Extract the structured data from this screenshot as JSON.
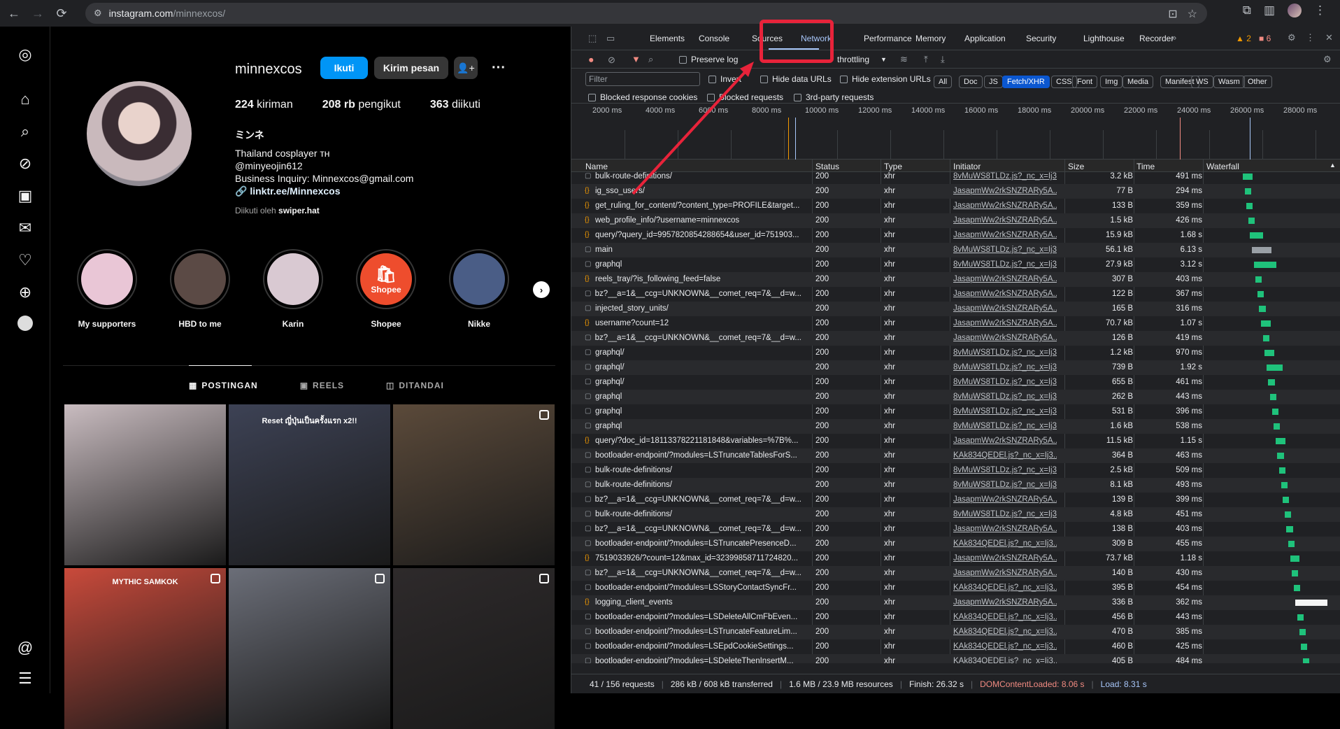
{
  "browser": {
    "url_domain": "instagram.com",
    "url_path": "/minnexcos/"
  },
  "profile": {
    "username": "minnexcos",
    "follow_label": "Ikuti",
    "message_label": "Kirim pesan",
    "posts_count": "224",
    "posts_label": "kiriman",
    "followers_count": "208 rb",
    "followers_label": "pengikut",
    "following_count": "363",
    "following_label": "diikuti",
    "fullname": "ミンネ",
    "bio_line1": "Thailand cosplayer ᴛʜ",
    "bio_line2": "@minyeojin612",
    "bio_line3": "Business Inquiry: Minnexcos@gmail.com",
    "bio_link": "linktr.ee/Minnexcos",
    "followed_by_prefix": "Diikuti oleh",
    "followed_by_user": "swiper.hat"
  },
  "highlights": [
    {
      "label": "My supporters",
      "color": "#e9c6d6"
    },
    {
      "label": "HBD to me",
      "color": "#5b4a45"
    },
    {
      "label": "Karin",
      "color": "#d9c9d2"
    },
    {
      "label": "Shopee",
      "color": "#ee4d2d",
      "logo": "Shopee"
    },
    {
      "label": "Nikke",
      "color": "#4a5d86"
    }
  ],
  "ig_tabs": {
    "posts": "POSTINGAN",
    "reels": "REELS",
    "tagged": "DITANDAI"
  },
  "posts": [
    {
      "color": "#c9bcc0",
      "caption": ""
    },
    {
      "color": "#3d4255",
      "caption": "Reset ญี่ปุ่นเป็นครั้งแรก x2!!"
    },
    {
      "color": "#5b4a3a",
      "caption": ""
    },
    {
      "color": "#c94a3b",
      "caption": "MYTHIC SAMKOK"
    },
    {
      "color": "#6b6e78",
      "caption": ""
    },
    {
      "color": "#2e2a2b",
      "caption": ""
    }
  ],
  "devtools": {
    "tabs": [
      "Elements",
      "Console",
      "Sources",
      "Network",
      "Performance",
      "Memory",
      "Application",
      "Security",
      "Lighthouse",
      "Recorder"
    ],
    "active_tab": "Network",
    "warnings": "2",
    "errors": "6",
    "preserve_log": "Preserve log",
    "throttling": "throttling",
    "filter_placeholder": "Filter",
    "invert": "Invert",
    "hide_data_urls": "Hide data URLs",
    "hide_ext_urls": "Hide extension URLs",
    "type_filters": [
      "All",
      "Doc",
      "JS",
      "Fetch/XHR",
      "CSS",
      "Font",
      "Img",
      "Media",
      "Manifest",
      "WS",
      "Wasm",
      "Other"
    ],
    "blocked_cookies": "Blocked response cookies",
    "blocked_requests": "Blocked requests",
    "third_party": "3rd-party requests",
    "timeline_ticks": [
      "2000 ms",
      "4000 ms",
      "6000 ms",
      "8000 ms",
      "10000 ms",
      "12000 ms",
      "14000 ms",
      "16000 ms",
      "18000 ms",
      "20000 ms",
      "22000 ms",
      "24000 ms",
      "26000 ms",
      "28000 ms"
    ],
    "columns": {
      "name": "Name",
      "status": "Status",
      "type": "Type",
      "initiator": "Initiator",
      "size": "Size",
      "time": "Time",
      "waterfall": "Waterfall"
    },
    "requests": [
      {
        "name": "bulk-route-definitions/",
        "status": "200",
        "type": "xhr",
        "init": "8vMuWS8TLDz.js?_nc_x=Ij3...",
        "size": "3.2 kB",
        "time": "491 ms",
        "wf": 0.03
      },
      {
        "name": "ig_sso_users/",
        "status": "200",
        "type": "xhr",
        "init": "JasapmWw2rkSNZRARy5A...",
        "size": "77 B",
        "time": "294 ms",
        "wf": 0.02
      },
      {
        "name": "get_ruling_for_content/?content_type=PROFILE&target...",
        "status": "200",
        "type": "xhr",
        "init": "JasapmWw2rkSNZRARy5A...",
        "size": "133 B",
        "time": "359 ms",
        "wf": 0.02
      },
      {
        "name": "web_profile_info/?username=minnexcos",
        "status": "200",
        "type": "xhr",
        "init": "JasapmWw2rkSNZRARy5A...",
        "size": "1.5 kB",
        "time": "426 ms",
        "wf": 0.02
      },
      {
        "name": "query/?query_id=9957820854288654&user_id=751903...",
        "status": "200",
        "type": "xhr",
        "init": "JasapmWw2rkSNZRARy5A...",
        "size": "15.9 kB",
        "time": "1.68 s",
        "wf": 0.04
      },
      {
        "name": "main",
        "status": "200",
        "type": "xhr",
        "init": "8vMuWS8TLDz.js?_nc_x=Ij3...",
        "size": "56.1 kB",
        "time": "6.13 s",
        "wf": 0.06
      },
      {
        "name": "graphql",
        "status": "200",
        "type": "xhr",
        "init": "8vMuWS8TLDz.js?_nc_x=Ij3...",
        "size": "27.9 kB",
        "time": "3.12 s",
        "wf": 0.07
      },
      {
        "name": "reels_tray/?is_following_feed=false",
        "status": "200",
        "type": "xhr",
        "init": "JasapmWw2rkSNZRARy5A...",
        "size": "307 B",
        "time": "403 ms",
        "wf": 0.02
      },
      {
        "name": "bz?__a=1&__ccg=UNKNOWN&__comet_req=7&__d=w...",
        "status": "200",
        "type": "xhr",
        "init": "JasapmWw2rkSNZRARy5A...",
        "size": "122 B",
        "time": "367 ms",
        "wf": 0.02
      },
      {
        "name": "injected_story_units/",
        "status": "200",
        "type": "xhr",
        "init": "JasapmWw2rkSNZRARy5A...",
        "size": "165 B",
        "time": "316 ms",
        "wf": 0.02
      },
      {
        "name": "username?count=12",
        "status": "200",
        "type": "xhr",
        "init": "JasapmWw2rkSNZRARy5A...",
        "size": "70.7 kB",
        "time": "1.07 s",
        "wf": 0.03
      },
      {
        "name": "bz?__a=1&__ccg=UNKNOWN&__comet_req=7&__d=w...",
        "status": "200",
        "type": "xhr",
        "init": "JasapmWw2rkSNZRARy5A...",
        "size": "126 B",
        "time": "419 ms",
        "wf": 0.02
      },
      {
        "name": "graphql/",
        "status": "200",
        "type": "xhr",
        "init": "8vMuWS8TLDz.js?_nc_x=Ij3...",
        "size": "1.2 kB",
        "time": "970 ms",
        "wf": 0.03
      },
      {
        "name": "graphql/",
        "status": "200",
        "type": "xhr",
        "init": "8vMuWS8TLDz.js?_nc_x=Ij3...",
        "size": "739 B",
        "time": "1.92 s",
        "wf": 0.05
      },
      {
        "name": "graphql/",
        "status": "200",
        "type": "xhr",
        "init": "8vMuWS8TLDz.js?_nc_x=Ij3...",
        "size": "655 B",
        "time": "461 ms",
        "wf": 0.02
      },
      {
        "name": "graphql",
        "status": "200",
        "type": "xhr",
        "init": "8vMuWS8TLDz.js?_nc_x=Ij3...",
        "size": "262 B",
        "time": "443 ms",
        "wf": 0.02
      },
      {
        "name": "graphql",
        "status": "200",
        "type": "xhr",
        "init": "8vMuWS8TLDz.js?_nc_x=Ij3...",
        "size": "531 B",
        "time": "396 ms",
        "wf": 0.02
      },
      {
        "name": "graphql",
        "status": "200",
        "type": "xhr",
        "init": "8vMuWS8TLDz.js?_nc_x=Ij3...",
        "size": "1.6 kB",
        "time": "538 ms",
        "wf": 0.02
      },
      {
        "name": "query/?doc_id=18113378221181848&variables=%7B%...",
        "status": "200",
        "type": "xhr",
        "init": "JasapmWw2rkSNZRARy5A...",
        "size": "11.5 kB",
        "time": "1.15 s",
        "wf": 0.03
      },
      {
        "name": "bootloader-endpoint/?modules=LSTruncateTablesForS...",
        "status": "200",
        "type": "xhr",
        "init": "KAk834QEDEl.js?_nc_x=Ij3...",
        "size": "364 B",
        "time": "463 ms",
        "wf": 0.02
      },
      {
        "name": "bulk-route-definitions/",
        "status": "200",
        "type": "xhr",
        "init": "8vMuWS8TLDz.js?_nc_x=Ij3...",
        "size": "2.5 kB",
        "time": "509 ms",
        "wf": 0.02
      },
      {
        "name": "bulk-route-definitions/",
        "status": "200",
        "type": "xhr",
        "init": "8vMuWS8TLDz.js?_nc_x=Ij3...",
        "size": "8.1 kB",
        "time": "493 ms",
        "wf": 0.02
      },
      {
        "name": "bz?__a=1&__ccg=UNKNOWN&__comet_req=7&__d=w...",
        "status": "200",
        "type": "xhr",
        "init": "JasapmWw2rkSNZRARy5A...",
        "size": "139 B",
        "time": "399 ms",
        "wf": 0.02
      },
      {
        "name": "bulk-route-definitions/",
        "status": "200",
        "type": "xhr",
        "init": "8vMuWS8TLDz.js?_nc_x=Ij3...",
        "size": "4.8 kB",
        "time": "451 ms",
        "wf": 0.02
      },
      {
        "name": "bz?__a=1&__ccg=UNKNOWN&__comet_req=7&__d=w...",
        "status": "200",
        "type": "xhr",
        "init": "JasapmWw2rkSNZRARy5A...",
        "size": "138 B",
        "time": "403 ms",
        "wf": 0.02
      },
      {
        "name": "bootloader-endpoint/?modules=LSTruncatePresenceD...",
        "status": "200",
        "type": "xhr",
        "init": "KAk834QEDEl.js?_nc_x=Ij3...",
        "size": "309 B",
        "time": "455 ms",
        "wf": 0.02
      },
      {
        "name": "7519033926/?count=12&max_id=32399858711724820...",
        "status": "200",
        "type": "xhr",
        "init": "JasapmWw2rkSNZRARy5A...",
        "size": "73.7 kB",
        "time": "1.18 s",
        "wf": 0.03
      },
      {
        "name": "bz?__a=1&__ccg=UNKNOWN&__comet_req=7&__d=w...",
        "status": "200",
        "type": "xhr",
        "init": "JasapmWw2rkSNZRARy5A...",
        "size": "140 B",
        "time": "430 ms",
        "wf": 0.02
      },
      {
        "name": "bootloader-endpoint/?modules=LSStoryContactSyncFr...",
        "status": "200",
        "type": "xhr",
        "init": "KAk834QEDEl.js?_nc_x=Ij3...",
        "size": "395 B",
        "time": "454 ms",
        "wf": 0.02
      },
      {
        "name": "logging_client_events",
        "status": "200",
        "type": "xhr",
        "init": "JasapmWw2rkSNZRARy5A...",
        "size": "336 B",
        "time": "362 ms",
        "wf": 0.1
      },
      {
        "name": "bootloader-endpoint/?modules=LSDeleteAllCmFbEven...",
        "status": "200",
        "type": "xhr",
        "init": "KAk834QEDEl.js?_nc_x=Ij3...",
        "size": "456 B",
        "time": "443 ms",
        "wf": 0.02
      },
      {
        "name": "bootloader-endpoint/?modules=LSTruncateFeatureLim...",
        "status": "200",
        "type": "xhr",
        "init": "KAk834QEDEl.js?_nc_x=Ij3...",
        "size": "470 B",
        "time": "385 ms",
        "wf": 0.02
      },
      {
        "name": "bootloader-endpoint/?modules=LSEpdCookieSettings...",
        "status": "200",
        "type": "xhr",
        "init": "KAk834QEDEl.js?_nc_x=Ij3...",
        "size": "460 B",
        "time": "425 ms",
        "wf": 0.02
      },
      {
        "name": "bootloader-endpoint/?modules=LSDeleteThenInsertM...",
        "status": "200",
        "type": "xhr",
        "init": "KAk834QEDEl.js?_nc_x=Ij3...",
        "size": "405 B",
        "time": "484 ms",
        "wf": 0.02
      }
    ],
    "status_bar": {
      "requests": "41 / 156 requests",
      "transferred": "286 kB / 608 kB transferred",
      "resources": "1.6 MB / 23.9 MB resources",
      "finish": "Finish: 26.32 s",
      "dcl": "DOMContentLoaded: 8.06 s",
      "load": "Load: 8.31 s"
    }
  },
  "annotation_color": "#e8233a"
}
